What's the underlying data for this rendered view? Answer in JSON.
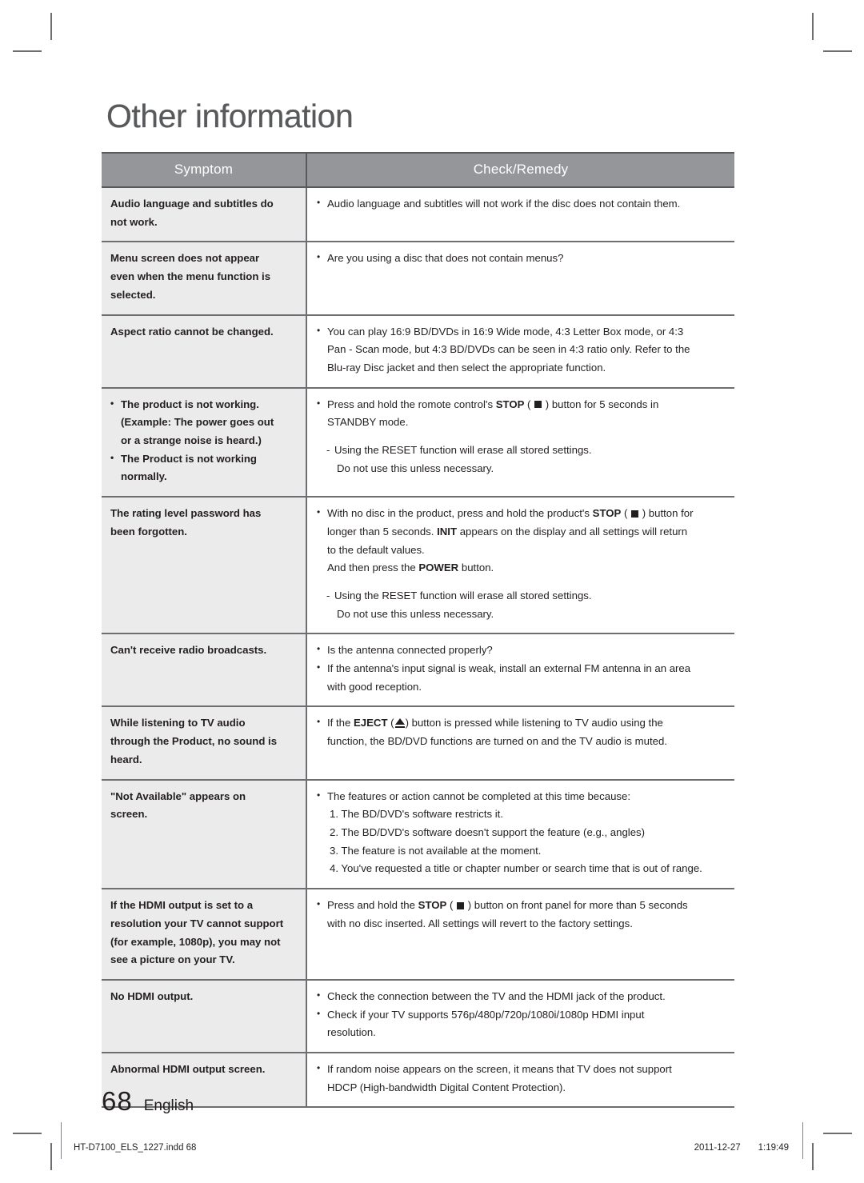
{
  "chapter": {
    "title": "Other information"
  },
  "table": {
    "headers": {
      "symptom": "Symptom",
      "remedy": "Check/Remedy"
    },
    "rows": [
      {
        "symptom_lines": [
          "Audio language and subtitles do",
          "not work."
        ],
        "remedy": {
          "b1": "Audio language and subtitles will not work if the disc does not contain them."
        }
      },
      {
        "symptom_lines": [
          "Menu screen does not appear",
          "even when the menu function is",
          "selected."
        ],
        "remedy": {
          "b1": "Are you using a disc that does not contain menus?"
        }
      },
      {
        "symptom_lines": [
          "Aspect ratio cannot be changed."
        ],
        "remedy": {
          "b1": "You can play 16:9 BD/DVDs in 16:9 Wide mode, 4:3 Letter Box mode, or 4:3",
          "b1c1": "Pan - Scan mode, but 4:3 BD/DVDs can be seen in 4:3 ratio only. Refer to the",
          "b1c2": "Blu-ray Disc jacket and then select the appropriate function."
        }
      },
      {
        "symptom_bullets": {
          "s1l1": "The product is not working.",
          "s1l2": "(Example: The power goes out",
          "s1l3": "or a strange noise is heard.)",
          "s2l1": "The Product is not working",
          "s2l2": "normally."
        },
        "remedy": {
          "pre": "Press and hold the romote control's",
          "stop": "STOP",
          "post": ") button for 5 seconds in",
          "line2": "STANDBY mode.",
          "dash1": "Using the RESET function will erase all stored settings.",
          "dash1c": "Do not use this unless necessary."
        }
      },
      {
        "symptom_lines": [
          "The rating level password has",
          "been forgotten."
        ],
        "remedy": {
          "pre": "With no disc in the product, press and hold the product's",
          "stop": "STOP",
          "post": ") button for",
          "l2a": "longer than 5 seconds.",
          "init": "INIT",
          "l2b": "appears on the display and all settings will return",
          "l3": "to the default values.",
          "l4a": "And then press the",
          "power": "POWER",
          "l4b": "button.",
          "dash1": "Using the RESET function will erase all stored settings.",
          "dash1c": "Do not use this unless necessary."
        }
      },
      {
        "symptom_lines": [
          "Can't receive radio broadcasts."
        ],
        "remedy": {
          "b1": "Is the antenna connected properly?",
          "b2": "If the antenna's input signal is weak, install an external FM antenna in an area",
          "b2c": "with good reception."
        }
      },
      {
        "symptom_lines": [
          "While listening to TV audio",
          "through the Product, no sound is",
          "heard."
        ],
        "remedy": {
          "pre": "If the",
          "eject": "EJECT",
          "post": ") button is pressed while listening to TV audio using the",
          "line2": "function, the BD/DVD functions are turned on and the TV audio is muted."
        }
      },
      {
        "symptom_lines": [
          "\"Not Available\" appears on",
          "screen."
        ],
        "remedy": {
          "b1": "The features or action cannot be completed at this time because:",
          "n1": "1. The BD/DVD's software restricts it.",
          "n2": "2. The BD/DVD's software doesn't support the feature (e.g., angles)",
          "n3": "3. The feature is not available at the moment.",
          "n4": "4. You've requested a title or chapter number or search time that is out of range."
        }
      },
      {
        "symptom_lines": [
          "If the HDMI output is set to a",
          "resolution your TV cannot support",
          "(for example, 1080p), you may not",
          "see a picture on your TV."
        ],
        "remedy": {
          "pre": "Press and hold the",
          "stop": "STOP",
          "post": ") button on front panel for more than 5 seconds",
          "line2": "with no disc inserted. All settings will revert to the factory settings."
        }
      },
      {
        "symptom_lines": [
          "No HDMI output."
        ],
        "remedy": {
          "b1": "Check the connection between the TV and the HDMI jack of the product.",
          "b2": "Check if your TV supports 576p/480p/720p/1080i/1080p HDMI input",
          "b2c": "resolution."
        }
      },
      {
        "symptom_lines": [
          "Abnormal HDMI output screen."
        ],
        "remedy": {
          "b1": "If random noise appears on the screen, it means that TV does not support",
          "b1c": "HDCP (High-bandwidth Digital Content Protection)."
        }
      }
    ]
  },
  "footer": {
    "page_number": "68",
    "language": "English",
    "file_info": "HT-D7100_ELS_1227.indd   68",
    "date": "2011-12-27",
    "time": "1:19:49"
  },
  "colors": {
    "header_gray": "#949699",
    "symptom_bg": "#ebebeb",
    "rule": "#6d6e71",
    "title_gray": "#58595b"
  }
}
